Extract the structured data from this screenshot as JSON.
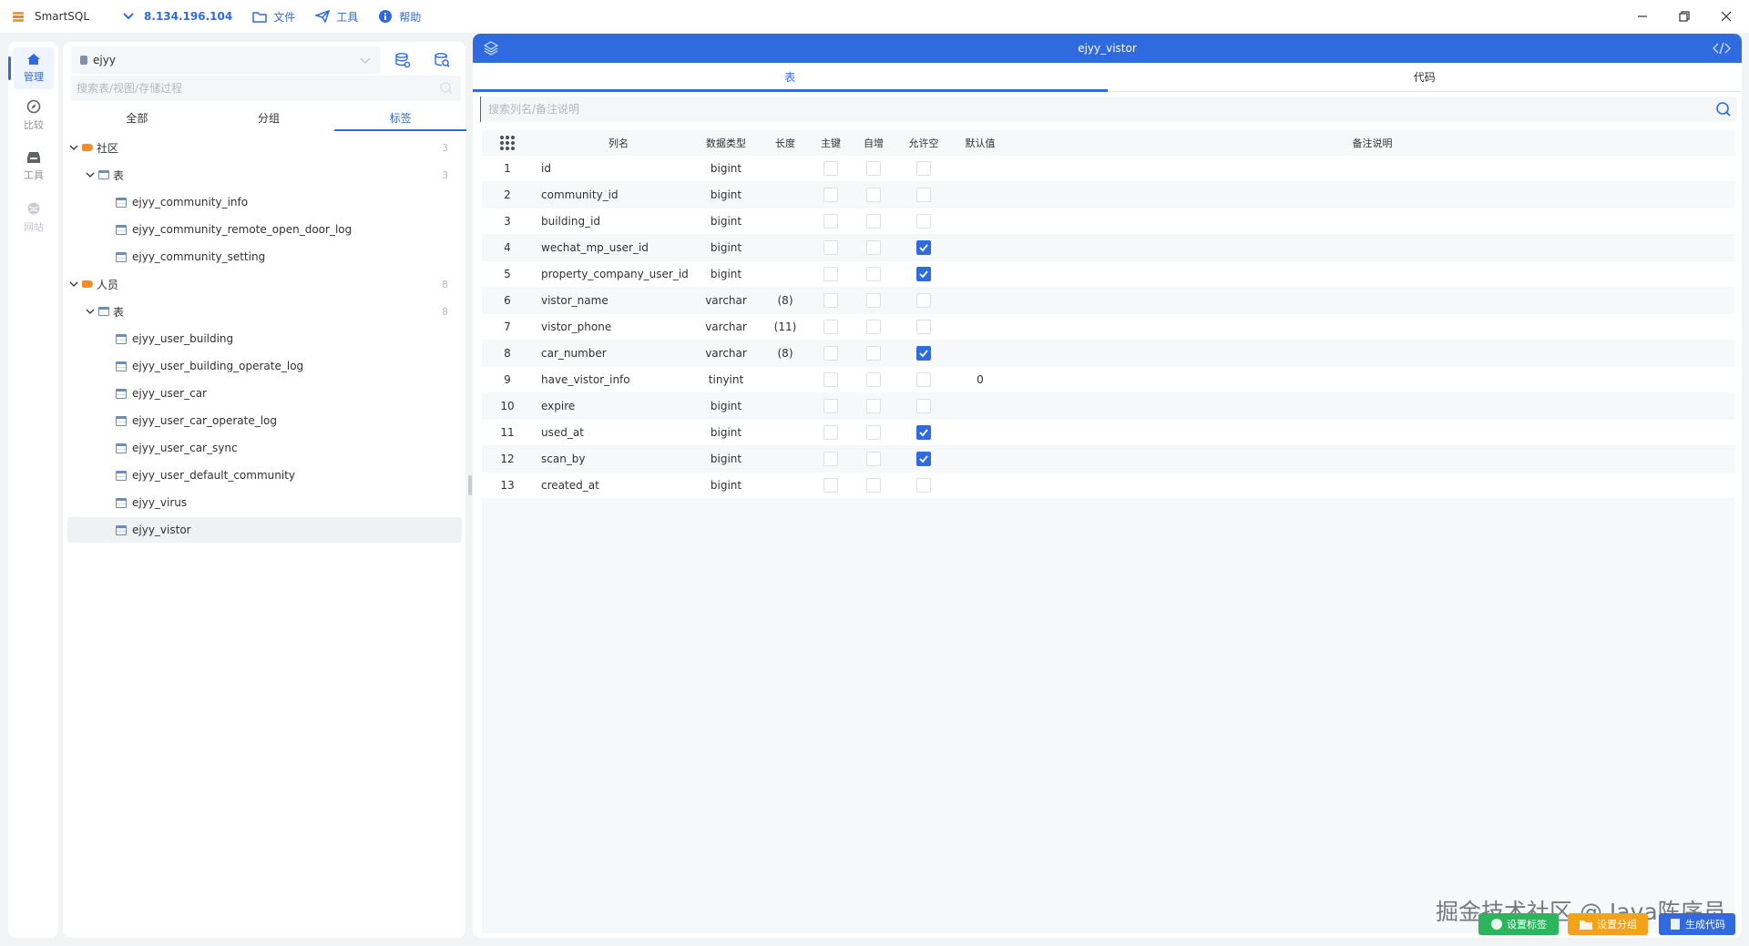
{
  "app": {
    "name": "SmartSQL",
    "connection": "8.134.196.104",
    "menus": [
      {
        "icon": "folder-icon",
        "label": "文件"
      },
      {
        "icon": "send-icon",
        "label": "工具"
      },
      {
        "icon": "info-icon",
        "label": "帮助"
      }
    ]
  },
  "rail": [
    {
      "icon": "home-icon",
      "label": "管理",
      "state": "active"
    },
    {
      "icon": "compass-icon",
      "label": "比较",
      "state": "normal"
    },
    {
      "icon": "inbox-icon",
      "label": "工具",
      "state": "normal"
    },
    {
      "icon": "globe-icon",
      "label": "网站",
      "state": "disabled"
    }
  ],
  "object_panel": {
    "database": "ejyy",
    "search_placeholder": "搜索表/视图/存储过程",
    "tabs": [
      {
        "label": "全部",
        "active": false
      },
      {
        "label": "分组",
        "active": false
      },
      {
        "label": "标签",
        "active": true
      }
    ],
    "tree": [
      {
        "type": "tag",
        "label": "社区",
        "count": "3",
        "level": 0
      },
      {
        "type": "folder",
        "label": "表",
        "count": "3",
        "level": 1
      },
      {
        "type": "table",
        "label": "ejyy_community_info",
        "level": 2
      },
      {
        "type": "table",
        "label": "ejyy_community_remote_open_door_log",
        "level": 2
      },
      {
        "type": "table",
        "label": "ejyy_community_setting",
        "level": 2
      },
      {
        "type": "tag",
        "label": "人员",
        "count": "8",
        "level": 0
      },
      {
        "type": "folder",
        "label": "表",
        "count": "8",
        "level": 1
      },
      {
        "type": "table",
        "label": "ejyy_user_building",
        "level": 2
      },
      {
        "type": "table",
        "label": "ejyy_user_building_operate_log",
        "level": 2
      },
      {
        "type": "table",
        "label": "ejyy_user_car",
        "level": 2
      },
      {
        "type": "table",
        "label": "ejyy_user_car_operate_log",
        "level": 2
      },
      {
        "type": "table",
        "label": "ejyy_user_car_sync",
        "level": 2
      },
      {
        "type": "table",
        "label": "ejyy_user_default_community",
        "level": 2
      },
      {
        "type": "table",
        "label": "ejyy_virus",
        "level": 2
      },
      {
        "type": "table",
        "label": "ejyy_vistor",
        "level": 2,
        "selected": true
      }
    ]
  },
  "main": {
    "title": "ejyy_vistor",
    "tabs": [
      {
        "label": "表",
        "active": true
      },
      {
        "label": "代码",
        "active": false
      }
    ],
    "search_placeholder": "搜索列名/备注说明",
    "columns": {
      "name": "列名",
      "type": "数据类型",
      "length": "长度",
      "pk": "主键",
      "ai": "自增",
      "nullable": "允许空",
      "default": "默认值",
      "comment": "备注说明"
    },
    "rows": [
      {
        "idx": "1",
        "name": "id",
        "type": "bigint",
        "length": "",
        "pk": false,
        "ai": false,
        "nullable": false,
        "default": "",
        "comment": ""
      },
      {
        "idx": "2",
        "name": "community_id",
        "type": "bigint",
        "length": "",
        "pk": false,
        "ai": false,
        "nullable": false,
        "default": "",
        "comment": ""
      },
      {
        "idx": "3",
        "name": "building_id",
        "type": "bigint",
        "length": "",
        "pk": false,
        "ai": false,
        "nullable": false,
        "default": "",
        "comment": ""
      },
      {
        "idx": "4",
        "name": "wechat_mp_user_id",
        "type": "bigint",
        "length": "",
        "pk": false,
        "ai": false,
        "nullable": true,
        "default": "",
        "comment": ""
      },
      {
        "idx": "5",
        "name": "property_company_user_id",
        "type": "bigint",
        "length": "",
        "pk": false,
        "ai": false,
        "nullable": true,
        "default": "",
        "comment": ""
      },
      {
        "idx": "6",
        "name": "vistor_name",
        "type": "varchar",
        "length": "(8)",
        "pk": false,
        "ai": false,
        "nullable": false,
        "default": "",
        "comment": ""
      },
      {
        "idx": "7",
        "name": "vistor_phone",
        "type": "varchar",
        "length": "(11)",
        "pk": false,
        "ai": false,
        "nullable": false,
        "default": "",
        "comment": ""
      },
      {
        "idx": "8",
        "name": "car_number",
        "type": "varchar",
        "length": "(8)",
        "pk": false,
        "ai": false,
        "nullable": true,
        "default": "",
        "comment": ""
      },
      {
        "idx": "9",
        "name": "have_vistor_info",
        "type": "tinyint",
        "length": "",
        "pk": false,
        "ai": false,
        "nullable": false,
        "default": "0",
        "comment": ""
      },
      {
        "idx": "10",
        "name": "expire",
        "type": "bigint",
        "length": "",
        "pk": false,
        "ai": false,
        "nullable": false,
        "default": "",
        "comment": ""
      },
      {
        "idx": "11",
        "name": "used_at",
        "type": "bigint",
        "length": "",
        "pk": false,
        "ai": false,
        "nullable": true,
        "default": "",
        "comment": ""
      },
      {
        "idx": "12",
        "name": "scan_by",
        "type": "bigint",
        "length": "",
        "pk": false,
        "ai": false,
        "nullable": true,
        "default": "",
        "comment": ""
      },
      {
        "idx": "13",
        "name": "created_at",
        "type": "bigint",
        "length": "",
        "pk": false,
        "ai": false,
        "nullable": false,
        "default": "",
        "comment": ""
      }
    ]
  },
  "bottom_buttons": [
    {
      "label": "设置标签",
      "color": "#2db55d"
    },
    {
      "label": "设置分组",
      "color": "#f2a31b"
    },
    {
      "label": "生成代码",
      "color": "#2f6bde"
    }
  ],
  "watermark": "掘金技术社区 @ Java陈序员",
  "colors": {
    "accent": "#2f6bde",
    "tag": "#f08c2c"
  }
}
